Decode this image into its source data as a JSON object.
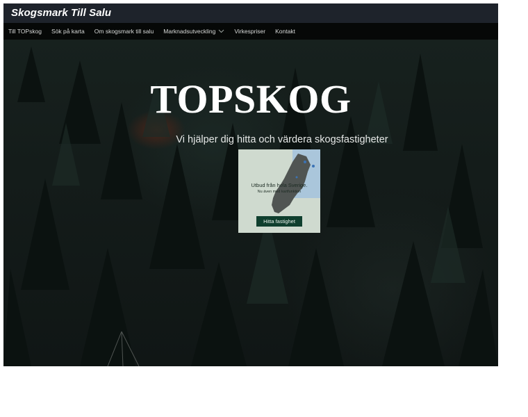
{
  "header": {
    "site_title": "Skogsmark Till Salu"
  },
  "nav": {
    "items": [
      {
        "label": "Till TOPskog"
      },
      {
        "label": "Sök på karta"
      },
      {
        "label": "Om skogsmark till salu"
      },
      {
        "label": "Marknadsutveckling",
        "has_dropdown": true
      },
      {
        "label": "Virkespriser"
      },
      {
        "label": "Kontakt"
      }
    ]
  },
  "hero": {
    "title": "TOPSKOG",
    "subtitle": "Vi hjälper dig hitta och värdera skogsfastigheter",
    "promo": {
      "line1": "Utbud från hela Sverige.",
      "line2": "Nu även med kartfunktion",
      "button_label": "Hitta fastighet"
    }
  },
  "colors": {
    "header_bg": "#1e232b",
    "nav_bg": "#060807",
    "promo_button": "#0f3f2e"
  }
}
